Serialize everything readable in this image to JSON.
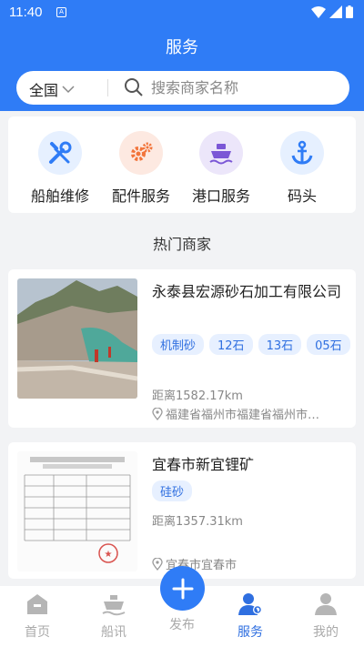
{
  "status_bar": {
    "time": "11:40",
    "sim_badge": "A"
  },
  "header": {
    "title": "服务"
  },
  "search": {
    "region": "全国",
    "placeholder": "搜索商家名称"
  },
  "categories": [
    {
      "label": "船舶维修",
      "icon": "wrench-screwdriver-icon",
      "color": "#2f7cf6",
      "bg": "#e6f0ff"
    },
    {
      "label": "配件服务",
      "icon": "gears-icon",
      "color": "#f2743a",
      "bg": "#fde9e1"
    },
    {
      "label": "港口服务",
      "icon": "ship-icon",
      "color": "#7b57d6",
      "bg": "#ece6fa"
    },
    {
      "label": "码头",
      "icon": "anchor-icon",
      "color": "#2f7cf6",
      "bg": "#e6f0ff"
    }
  ],
  "section": {
    "title": "热门商家"
  },
  "merchants": [
    {
      "name": "永泰县宏源砂石加工有限公司",
      "tags": [
        "机制砂",
        "12石",
        "13石",
        "05石"
      ],
      "distance": "距离1582.17km",
      "address": "福建省福州市福建省福州市…"
    },
    {
      "name": "宜春市新宜锂矿",
      "tags": [
        "硅砂"
      ],
      "distance": "距离1357.31km",
      "address": "宜春市宜春市"
    }
  ],
  "tabbar": {
    "items": [
      {
        "label": "首页",
        "icon": "home-icon"
      },
      {
        "label": "船讯",
        "icon": "ship-news-icon"
      },
      {
        "label": "发布",
        "icon": "plus-icon"
      },
      {
        "label": "服务",
        "icon": "service-user-icon"
      },
      {
        "label": "我的",
        "icon": "profile-icon"
      }
    ],
    "active": "服务"
  },
  "colors": {
    "primary": "#2f7cf6",
    "tag_bg": "#e7f0ff",
    "tag_text": "#2f6fe0"
  }
}
